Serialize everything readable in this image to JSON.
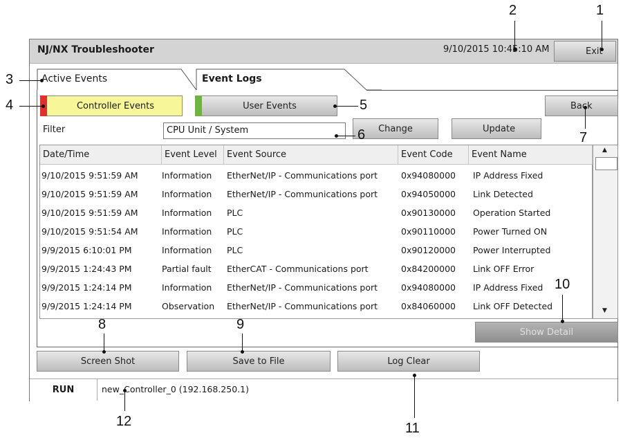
{
  "window": {
    "title": "NJ/NX Troubleshooter",
    "datetime": "9/10/2015 10:45:10 AM",
    "exit_label": "Exit"
  },
  "tabs": [
    {
      "label": "Active Events"
    },
    {
      "label": "Event Logs"
    }
  ],
  "event_buttons": {
    "controller": "Controller Events",
    "user": "User Events",
    "back": "Back"
  },
  "filter": {
    "label": "Filter",
    "value": "CPU Unit / System",
    "change": "Change",
    "update": "Update"
  },
  "table": {
    "columns": [
      "Date/Time",
      "Event Level",
      "Event Source",
      "Event Code",
      "Event Name"
    ],
    "rows": [
      [
        "9/10/2015 9:51:59 AM",
        "Information",
        "EtherNet/IP - Communications port",
        "0x94080000",
        "IP Address Fixed"
      ],
      [
        "9/10/2015 9:51:59 AM",
        "Information",
        "EtherNet/IP - Communications port",
        "0x94050000",
        "Link Detected"
      ],
      [
        "9/10/2015 9:51:59 AM",
        "Information",
        "PLC",
        "0x90130000",
        "Operation Started"
      ],
      [
        "9/10/2015 9:51:54 AM",
        "Information",
        "PLC",
        "0x90110000",
        "Power Turned ON"
      ],
      [
        "9/9/2015 6:10:01 PM",
        "Information",
        "PLC",
        "0x90120000",
        "Power Interrupted"
      ],
      [
        "9/9/2015 1:24:43 PM",
        "Partial fault",
        "EtherCAT - Communications port",
        "0x84200000",
        "Link OFF Error"
      ],
      [
        "9/9/2015 1:24:14 PM",
        "Information",
        "EtherNet/IP - Communications port",
        "0x94080000",
        "IP Address Fixed"
      ],
      [
        "9/9/2015 1:24:14 PM",
        "Observation",
        "EtherNet/IP - Communications port",
        "0x84060000",
        "Link OFF Detected"
      ]
    ]
  },
  "actions": {
    "show_detail": "Show Detail",
    "screen_shot": "Screen Shot",
    "save_to_file": "Save to File",
    "log_clear": "Log Clear"
  },
  "status": {
    "mode": "RUN",
    "controller": "new_Controller_0 (192.168.250.1)"
  },
  "callouts": [
    "1",
    "2",
    "3",
    "4",
    "5",
    "6",
    "7",
    "8",
    "9",
    "10",
    "11",
    "12"
  ],
  "colors": {
    "controller_indicator": "#e0302e",
    "user_indicator": "#6db33f",
    "controller_button": "#f7f79a"
  },
  "icons": [
    "scroll-up-icon",
    "scroll-down-icon"
  ]
}
